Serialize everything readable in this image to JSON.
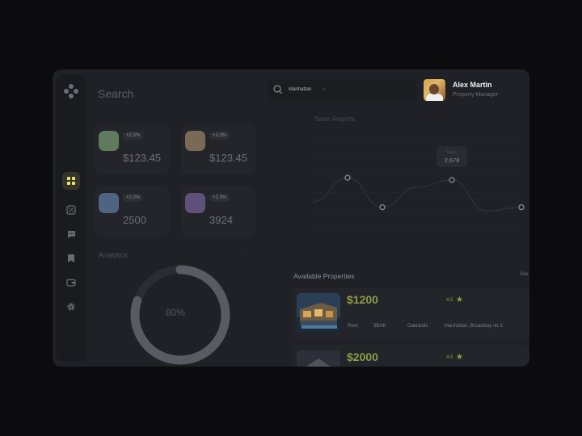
{
  "header": {
    "search_title": "Search",
    "search_value": "Manhattan",
    "clear_glyph": "×"
  },
  "profile": {
    "name": "Alex Martin",
    "role": "Property Manager"
  },
  "sidebar": {
    "items": [
      {
        "icon": "dashboard-icon",
        "active": true
      },
      {
        "icon": "percent-icon",
        "active": false
      },
      {
        "icon": "chat-icon",
        "active": false
      },
      {
        "icon": "bookmark-icon",
        "active": false
      },
      {
        "icon": "wallet-icon",
        "active": false
      },
      {
        "icon": "settings-icon",
        "active": false
      }
    ],
    "active_color": "#f3e36b"
  },
  "stats": [
    {
      "badge": "+2.3%",
      "label": "",
      "value": "$123.45",
      "color": "#5f7a5d"
    },
    {
      "badge": "+2.3%",
      "label": "",
      "value": "$123.45",
      "color": "#7a6a55"
    },
    {
      "badge": "+2.3%",
      "label": "",
      "value": "2500",
      "color": "#4f6382"
    },
    {
      "badge": "+2.3%",
      "label": "",
      "value": "3924",
      "color": "#5d5179"
    }
  ],
  "analytics": {
    "title": "Analytics",
    "more": "...",
    "percent": 80,
    "percent_label": "80%"
  },
  "sales": {
    "title": "Sales Reports",
    "tooltip_label": "Sales",
    "tooltip_value": "2,678"
  },
  "chart_data": {
    "type": "line",
    "title": "Sales Reports",
    "x": [
      0,
      1,
      2,
      3,
      4,
      5,
      6
    ],
    "series": [
      {
        "values": [
          1.5,
          2.8,
          1.2,
          2.3,
          2.678,
          1.0,
          1.2
        ]
      }
    ],
    "ylim": [
      0,
      5
    ],
    "grid": true,
    "highlight": {
      "index": 4,
      "label": "Sales",
      "value": "2,678"
    }
  },
  "properties": {
    "title": "Available Properties",
    "see_all": "See",
    "items": [
      {
        "price": "$1200",
        "rating": "4.5",
        "star": "★",
        "fields": [
          {
            "value": "Rent"
          },
          {
            "value": "3BHK"
          },
          {
            "value": "Oaklands"
          },
          {
            "value": "Manhattan, Broadway str 3"
          }
        ]
      },
      {
        "price": "$2000",
        "rating": "4.5",
        "star": "★",
        "fields": []
      }
    ]
  }
}
